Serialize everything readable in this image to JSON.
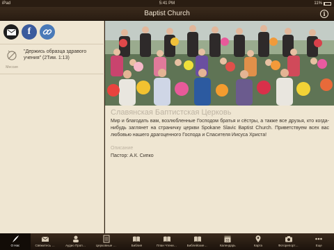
{
  "status_bar": {
    "carrier": "iPad",
    "time": "5:41 PM",
    "battery": "11%"
  },
  "nav": {
    "title": "Baptist Church"
  },
  "sidebar": {
    "social": [
      {
        "name": "email",
        "icon": "mail-icon"
      },
      {
        "name": "facebook",
        "icon": "facebook-icon",
        "glyph": "f"
      },
      {
        "name": "website",
        "icon": "link-icon"
      }
    ],
    "verse": {
      "icon_label": "Мессия",
      "text": "\"Держись образца здравого учения\" (2Тим. 1:13)"
    }
  },
  "main": {
    "church_name": "Славянская Баптистская Церковь",
    "description": "Мир и благодать вам, возлюбленные Господом братья и сёстры, а также все друзья, кто когда-нибудь заглянет на страничку церкви Spokane Slavic Baptist Church. Приветствуем всех вас любовью нашего драгоценного Господа и Спасителя Иисуса Христа!",
    "description_label": "Описание",
    "pastor": "Пастор: А.К. Сипко"
  },
  "tabs": [
    {
      "label": "О Нас",
      "icon": "feather-icon",
      "active": true
    },
    {
      "label": "Свяжитесь с нами",
      "icon": "envelope-icon",
      "active": false
    },
    {
      "label": "Аудио Проповеди",
      "icon": "audio-icon",
      "active": false
    },
    {
      "label": "Церковные Новости",
      "icon": "news-icon",
      "active": false
    },
    {
      "label": "Библия",
      "icon": "book-icon",
      "active": false
    },
    {
      "label": "План Чтения Библии",
      "icon": "book-plan-icon",
      "active": false
    },
    {
      "label": "Библейские Стихи",
      "icon": "book-verses-icon",
      "active": false
    },
    {
      "label": "Календарь",
      "icon": "calendar-icon",
      "glyph": "31",
      "active": false
    },
    {
      "label": "Карта",
      "icon": "map-pin-icon",
      "active": false
    },
    {
      "label": "Фоторепортаж",
      "icon": "camera-icon",
      "active": false
    },
    {
      "label": "Еще",
      "icon": "more-icon",
      "active": false
    }
  ],
  "colors": {
    "nav_bg": "#2a1d12",
    "panel_bg": "#efe6d2",
    "text": "#3b332a",
    "muted": "#bdb3a2"
  }
}
